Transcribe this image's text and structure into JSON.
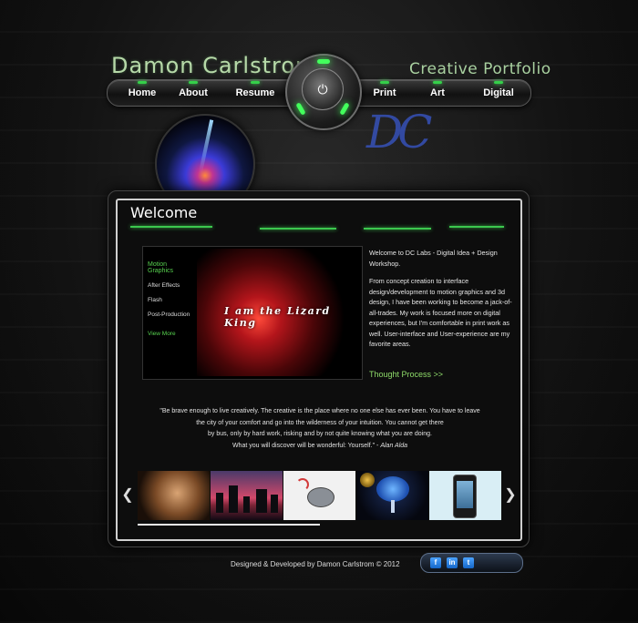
{
  "header": {
    "site_name": "Damon Carlstrom",
    "tagline": "Creative Portfolio",
    "monogram": "DC"
  },
  "nav": {
    "items": [
      "Home",
      "About",
      "Resume",
      "Print",
      "Art",
      "Digital"
    ],
    "power_icon": "power-icon"
  },
  "main": {
    "title": "Welcome",
    "showcase": {
      "menu_heading": "Motion Graphics",
      "menu_items": [
        "After Effects",
        "Flash",
        "Post-Production"
      ],
      "view_more": "View More",
      "art_title": "I am the Lizard King"
    },
    "intro": [
      "Welcome to DC Labs - Digital Idea + Design Workshop.",
      "From concept creation to interface design/development to motion graphics and 3d design, I have been working to become a jack-of-all-trades. My work is focused more on digital experiences, but I'm comfortable in print work as well. User-interface and User-experience are my favorite areas."
    ],
    "thought_link": "Thought Process >>",
    "quote": {
      "lines": [
        "\"Be brave enough to live creatively. The creative is the place where no one else has ever been. You have to leave",
        "the city of your comfort and go into the wilderness of your intuition. You cannot get there",
        "by bus, only by hard work, risking and by not quite knowing what you are doing.",
        "What you will discover will be wonderful: Yourself.\" - "
      ],
      "author": "Alan Alda"
    }
  },
  "carousel": {
    "prev_icon": "chevron-left-icon",
    "next_icon": "chevron-right-icon",
    "thumbnails": [
      "portrait-artwork",
      "city-skyline",
      "robot-fish",
      "blue-tree",
      "smartphone"
    ]
  },
  "footer": {
    "credit": "Designed & Developed by Damon Carlstrom",
    "year": "© 2012",
    "social": [
      "facebook-icon",
      "linkedin-icon",
      "twitter-icon"
    ]
  },
  "colors": {
    "accent_green": "#3cc84e",
    "title_green": "#b6d9a8",
    "link_green": "#8fdc6a"
  }
}
